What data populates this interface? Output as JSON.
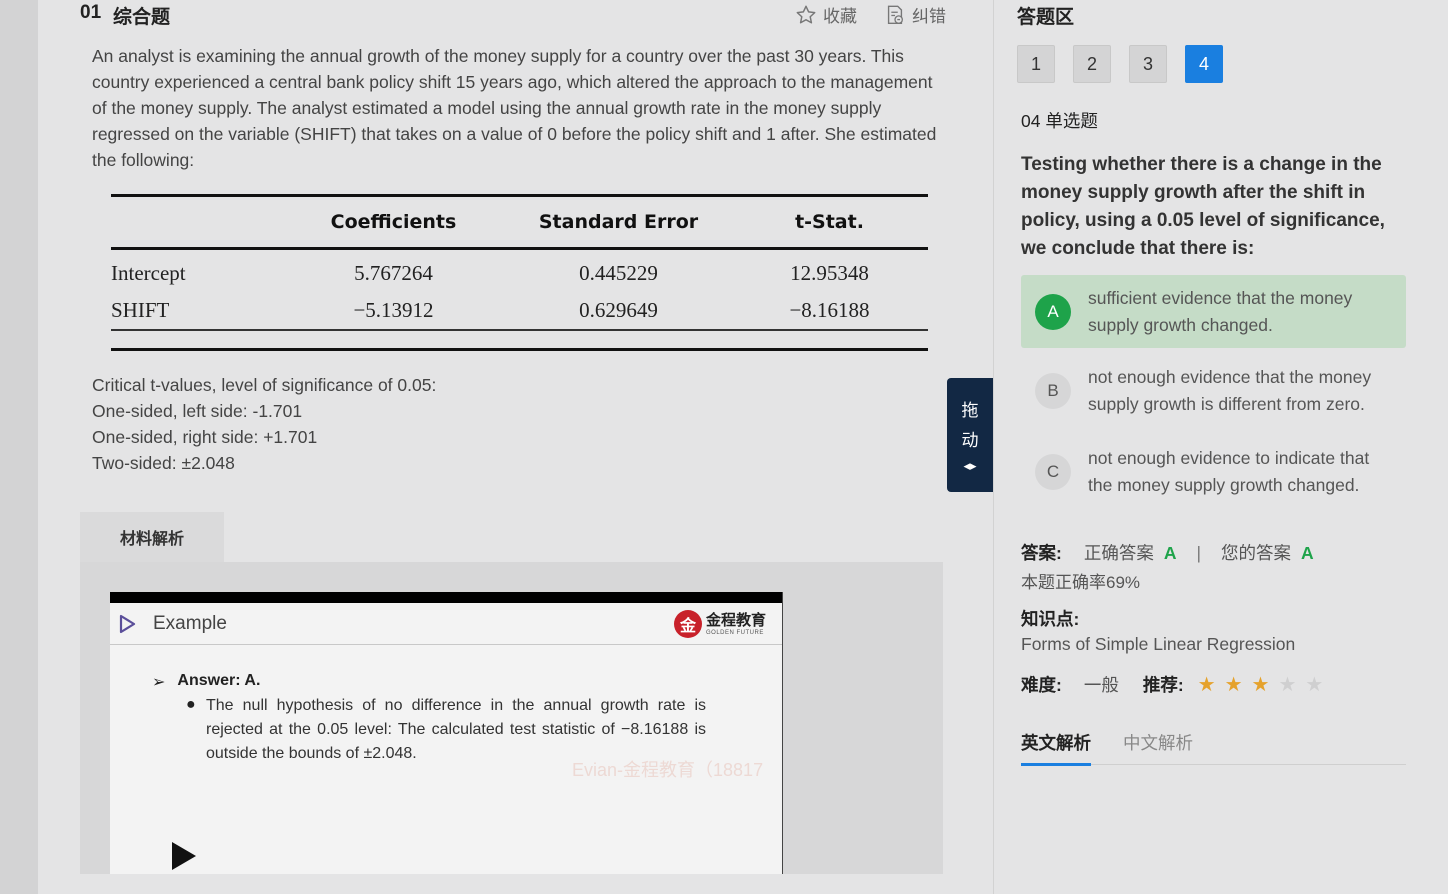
{
  "question": {
    "number": "01",
    "type": "综合题",
    "favorite_label": "收藏",
    "report_label": "纠错",
    "text": "An analyst is examining the annual growth of the money supply for a country over the past 30 years. This country experienced a central bank policy shift 15 years ago, which altered the approach to the management of the money supply. The analyst estimated a model using the annual growth rate in the money supply regressed on the variable (SHIFT) that takes on a value of 0 before the policy shift and 1 after. She estimated the following:",
    "table": {
      "headers": [
        "",
        "Coefficients",
        "Standard Error",
        "t-Stat."
      ],
      "rows": [
        [
          "Intercept",
          "5.767264",
          "0.445229",
          "12.95348"
        ],
        [
          "SHIFT",
          "−5.13912",
          "0.629649",
          "−8.16188"
        ]
      ]
    },
    "critical": {
      "line1": "Critical t-values, level of significance of 0.05:",
      "line2": "One-sided, left side: -1.701",
      "line3": "One-sided, right side: +1.701",
      "line4": "Two-sided: ±2.048"
    }
  },
  "material": {
    "tab_label": "材料解析",
    "video": {
      "slide_title": "Example",
      "brand_badge": "金",
      "brand_cn": "金程教育",
      "brand_en": "GOLDEN FUTURE",
      "answer_arrow": "➢",
      "answer_label": "Answer: A.",
      "bullet": "●",
      "bullet_text": "The null hypothesis of no difference in the annual growth rate is rejected at the 0.05 level: The calculated test statistic of −8.16188 is outside the bounds of ±2.048.",
      "watermark": "Evian-金程教育（18817"
    }
  },
  "drag_handle": {
    "char1": "拖",
    "char2": "动",
    "arrows": "◂▸"
  },
  "answer_panel": {
    "title": "答题区",
    "nav": [
      {
        "label": "1",
        "active": false
      },
      {
        "label": "2",
        "active": false
      },
      {
        "label": "3",
        "active": false
      },
      {
        "label": "4",
        "active": true
      }
    ],
    "sub_label": "04 单选题",
    "sub_question": "Testing whether there is a change in the money supply growth after the shift in policy, using a 0.05 level of significance, we conclude that there is:",
    "options": [
      {
        "letter": "A",
        "text": "sufficient evidence that the money supply growth changed.",
        "selected": true
      },
      {
        "letter": "B",
        "text": "not enough evidence that the money supply growth is different from zero.",
        "selected": false
      },
      {
        "letter": "C",
        "text": "not enough evidence to indicate that the money supply growth changed.",
        "selected": false
      }
    ],
    "answer_label": "答案:",
    "correct_label": "正确答案",
    "correct_value": "A",
    "separator": "|",
    "yours_label": "您的答案",
    "yours_value": "A",
    "accuracy": "本题正确率69%",
    "knowledge_label": "知识点:",
    "knowledge_value": "Forms of Simple Linear Regression",
    "difficulty_label": "难度:",
    "difficulty_value": "一般",
    "recommend_label": "推荐:",
    "recommend_stars": 3,
    "recommend_max": 5,
    "tabs": [
      "英文解析",
      "中文解析"
    ],
    "active_tab": 0,
    "accent_color": "#1a7fe0",
    "correct_color": "#1ea34a",
    "star_color": "#e5a22c"
  }
}
